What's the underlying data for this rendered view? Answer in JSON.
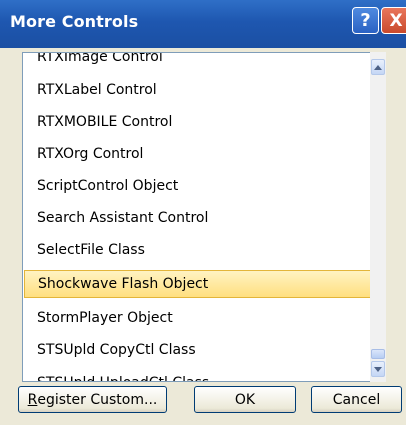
{
  "window": {
    "title": "More Controls",
    "help_glyph": "?",
    "close_glyph": "X"
  },
  "list": {
    "items": [
      {
        "label": "RTXImage Control",
        "selected": false
      },
      {
        "label": "RTXLabel Control",
        "selected": false
      },
      {
        "label": "RTXMOBILE Control",
        "selected": false
      },
      {
        "label": "RTXOrg Control",
        "selected": false
      },
      {
        "label": "ScriptControl Object",
        "selected": false
      },
      {
        "label": "Search Assistant Control",
        "selected": false
      },
      {
        "label": "SelectFile Class",
        "selected": false
      },
      {
        "label": "Shockwave Flash Object",
        "selected": true
      },
      {
        "label": "StormPlayer Object",
        "selected": false
      },
      {
        "label": "STSUpld CopyCtl Class",
        "selected": false
      },
      {
        "label": "STSUpld UploadCtl Class",
        "selected": false
      }
    ]
  },
  "buttons": {
    "register_mnemonic": "R",
    "register_rest": "egister Custom...",
    "ok": "OK",
    "cancel": "Cancel"
  },
  "colors": {
    "title_bar": "#1e57b0",
    "selection": "#ffdf80",
    "dialog_face": "#ece9d8"
  }
}
